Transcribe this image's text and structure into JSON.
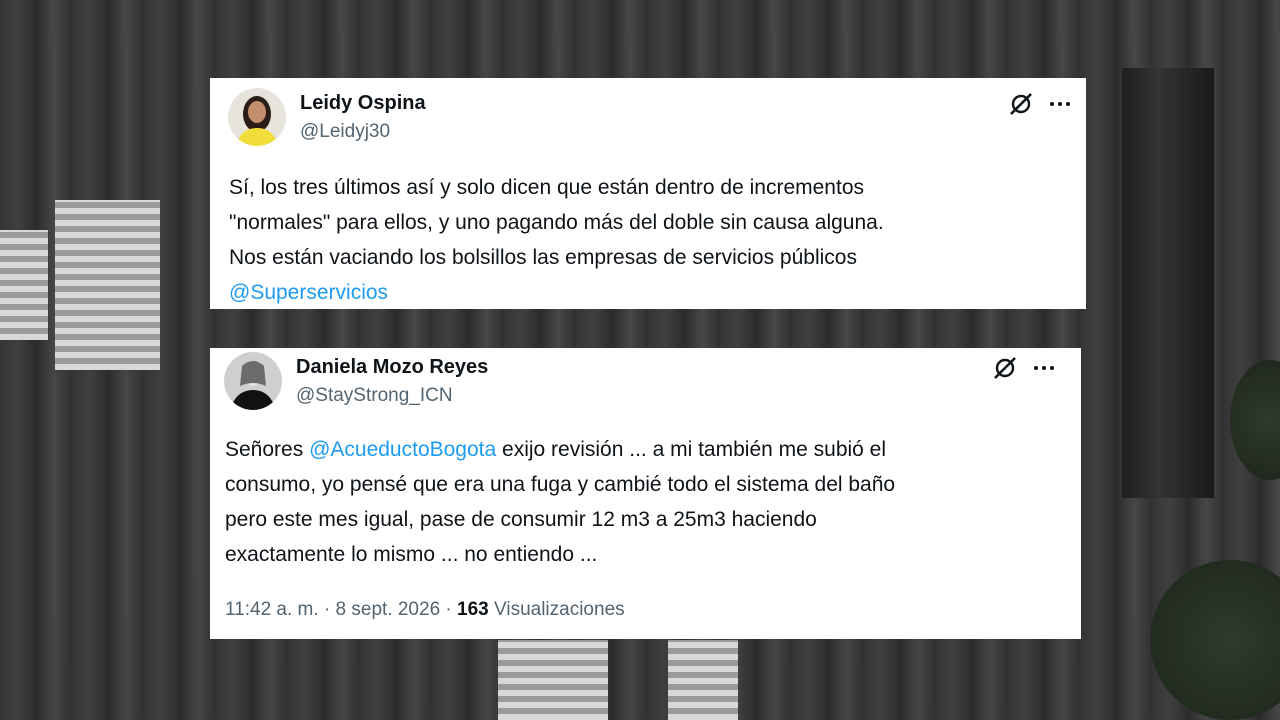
{
  "tweet1": {
    "name": "Leidy Ospina",
    "handle": "@Leidyj30",
    "line1": "Sí, los tres últimos así y solo dicen que están dentro de incrementos",
    "line2": "\"normales\" para ellos, y uno pagando más del doble sin causa alguna.",
    "line3": "Nos están vaciando los bolsillos las empresas de servicios públicos",
    "mention": "@Superservicios",
    "avatar_icon": "avatar-woman-yellow-top",
    "grok_icon": "grok-icon",
    "more_icon": "more-icon"
  },
  "tweet2": {
    "name": "Daniela Mozo Reyes",
    "handle": "@StayStrong_ICN",
    "line1_pre": "Señores ",
    "line1_mention": "@AcueductoBogota",
    "line1_post": " exijo revisión ... a mi también me subió el",
    "line2": "consumo, yo pensé que era una fuga y cambié todo el sistema del baño",
    "line3": "pero este mes igual, pase de consumir 12 m3 a 25m3 haciendo",
    "line4": "exactamente lo mismo ... no entiendo ...",
    "time": "11:42 a. m.",
    "separator": "·",
    "date": "8 sept. 2026",
    "views_count": "163",
    "views_label": "Visualizaciones",
    "avatar_icon": "avatar-woman-bw",
    "grok_icon": "grok-icon",
    "more_icon": "more-icon"
  },
  "colors": {
    "mention": "#1d9bf0",
    "text": "#0f1419",
    "secondary": "#536471"
  }
}
